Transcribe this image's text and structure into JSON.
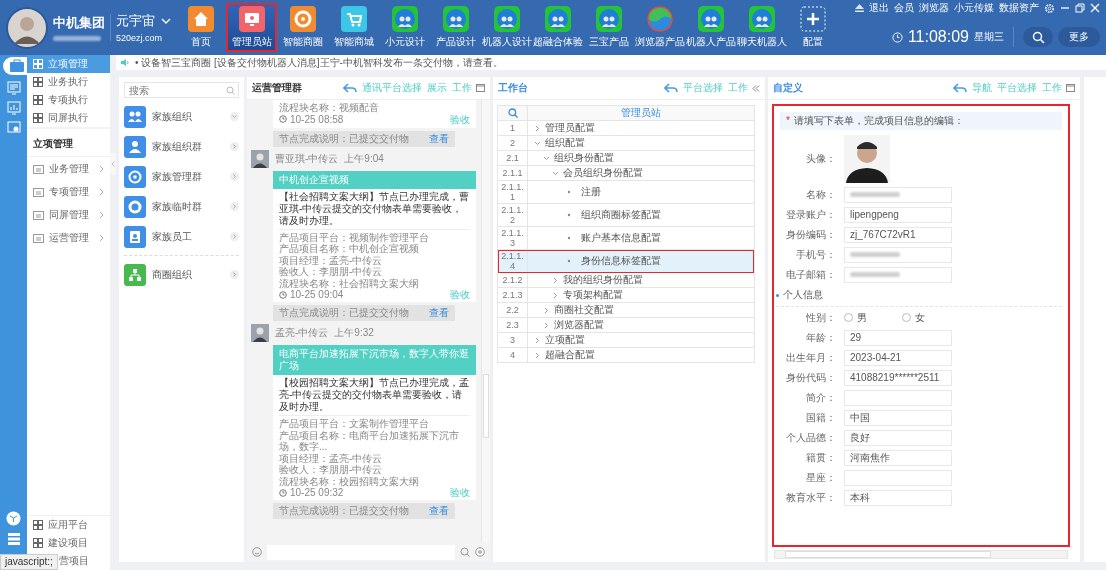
{
  "header": {
    "brand": "中机集团",
    "space": "元宇宙",
    "domain": "520ezj.com",
    "nav": [
      {
        "label": "首页",
        "kind": "home",
        "selected": false
      },
      {
        "label": "管理员站",
        "kind": "monitor",
        "selected": true
      },
      {
        "label": "智能商圈",
        "kind": "aperture",
        "selected": false
      },
      {
        "label": "智能商城",
        "kind": "cart",
        "selected": false
      },
      {
        "label": "小元设计",
        "kind": "globe",
        "selected": false
      },
      {
        "label": "产品设计",
        "kind": "globe",
        "selected": false
      },
      {
        "label": "机器人设计",
        "kind": "globe",
        "selected": false
      },
      {
        "label": "超融合体验",
        "kind": "globe",
        "selected": false
      },
      {
        "label": "三宝产品",
        "kind": "globe",
        "selected": false
      },
      {
        "label": "浏览器产品",
        "kind": "swirl",
        "selected": false
      },
      {
        "label": "机器人产品",
        "kind": "globe",
        "selected": false
      },
      {
        "label": "聊天机器人",
        "kind": "globe",
        "selected": false
      },
      {
        "label": "配置",
        "kind": "plus",
        "selected": false
      }
    ],
    "links": [
      "退出",
      "会员",
      "浏览器",
      "小元传媒",
      "数据资产"
    ],
    "time": "11:08:09",
    "weekday": "星期三",
    "more": "更多"
  },
  "sidebar": {
    "top": [
      {
        "label": "立项管理",
        "selected": true
      },
      {
        "label": "业务执行",
        "selected": false
      },
      {
        "label": "专项执行",
        "selected": false
      },
      {
        "label": "同屏执行",
        "selected": false
      }
    ],
    "heading": "立项管理",
    "folders": [
      "业务管理",
      "专项管理",
      "同屏管理",
      "运营管理"
    ],
    "bottom": [
      {
        "label": "应用平台"
      },
      {
        "label": "建设项目"
      }
    ],
    "covered_item": "营项目",
    "status_tip": "javascript:;"
  },
  "notice": "• 设备智三宝商圈 [设备交付物机器人消息]王宁-中机智科发布一条交付物，请查看。",
  "groups": {
    "placeholder": "搜索",
    "items": [
      {
        "label": "家族组织",
        "kind": "people",
        "expanded": true
      },
      {
        "label": "家族组织群",
        "kind": "person",
        "expanded": false
      },
      {
        "label": "家族管理群",
        "kind": "target",
        "expanded": false
      },
      {
        "label": "家族临时群",
        "kind": "ring",
        "expanded": false
      },
      {
        "label": "家族员工",
        "kind": "badge",
        "expanded": false
      },
      {
        "label": "商圈组织",
        "kind": "org",
        "expanded": false
      }
    ]
  },
  "chat": {
    "title": "运营管理群",
    "actions": [
      "通讯平台选择",
      "展示",
      "工作"
    ],
    "messages": [
      {
        "kind": "tail",
        "lines": [
          "流程块名称：视频配音"
        ],
        "stamp": "10-25 08:58",
        "action": "验收"
      },
      {
        "kind": "note",
        "text": "节点完成说明：已提交交付物",
        "link": "查看"
      },
      {
        "kind": "card",
        "sender": "曹亚琪-中传云",
        "time": "上午9:04",
        "banner": "中机创企宣视频",
        "body": "【社会招聘文案大纲】节点已办理完成，曹亚琪-中传云提交的交付物表单需要验收，请及时办理。",
        "lines": [
          "产品项目平台：视频制作管理平台",
          "产品项目名称：中机创企宣视频",
          "项目经理：孟亮-中传云",
          "验收人：李朋朋-中传云",
          "流程块名称：社会招聘文案大纲"
        ],
        "stamp": "10-25 09:04",
        "action": "验收"
      },
      {
        "kind": "note",
        "text": "节点完成说明：已提交交付物",
        "link": "查看"
      },
      {
        "kind": "card",
        "sender": "孟亮-中传云",
        "time": "上午9:32",
        "banner": "电商平台加速拓展下沉市场，数字人带你逛广场",
        "body": "【校园招聘文案大纲】节点已办理完成，孟亮-中传云提交的交付物表单需要验收，请及时办理。",
        "lines": [
          "产品项目平台：文案制作管理平台",
          "产品项目名称：电商平台加速拓展下沉市场，数字...",
          "项目经理：孟亮-中传云",
          "验收人：李朋朋-中传云",
          "流程块名称：校园招聘文案大纲"
        ],
        "stamp": "10-25 09:32",
        "action": "验收"
      },
      {
        "kind": "note",
        "text": "节点完成说明：已提交交付物",
        "link": "查看"
      }
    ]
  },
  "workbench": {
    "title": "工作台",
    "actions": [
      "平台选择",
      "工作"
    ],
    "column": "管理员站",
    "tree": [
      {
        "num": "1",
        "label": "管理员配置",
        "expanded": false,
        "selected": false
      },
      {
        "num": "2",
        "label": "组织配置",
        "expanded": true,
        "selected": false,
        "children": [
          {
            "num": "2.1",
            "label": "组织身份配置",
            "expanded": true,
            "selected": false,
            "children": [
              {
                "num": "2.1.1",
                "label": "会员组织身份配置",
                "expanded": true,
                "selected": false,
                "children": [
                  {
                    "num": "2.1.1.1",
                    "label": "注册",
                    "selected": false
                  },
                  {
                    "num": "2.1.1.2",
                    "label": "组织商圈标签配置",
                    "selected": false
                  },
                  {
                    "num": "2.1.1.3",
                    "label": "账户基本信息配置",
                    "selected": false
                  },
                  {
                    "num": "2.1.1.4",
                    "label": "身份信息标签配置",
                    "selected": true
                  }
                ]
              },
              {
                "num": "2.1.2",
                "label": "我的组织身份配置",
                "expanded": false,
                "selected": false
              },
              {
                "num": "2.1.3",
                "label": "专项架构配置",
                "expanded": false,
                "selected": false
              }
            ]
          },
          {
            "num": "2.2",
            "label": "商圈社交配置",
            "expanded": false,
            "selected": false
          },
          {
            "num": "2.3",
            "label": "浏览器配置",
            "expanded": false,
            "selected": false
          }
        ]
      },
      {
        "num": "3",
        "label": "立项配置",
        "expanded": false,
        "selected": false
      },
      {
        "num": "4",
        "label": "超融合配置",
        "expanded": false,
        "selected": false
      }
    ]
  },
  "form": {
    "title": "自定义",
    "actions": [
      "导航",
      "平台选择",
      "工作"
    ],
    "required_mark": "*",
    "hint": "请填写下表单，完成项目信息的编辑：",
    "fields": [
      {
        "label": "头像：",
        "kind": "avatar"
      },
      {
        "label": "名称：",
        "kind": "redacted"
      },
      {
        "label": "登录账户：",
        "kind": "text",
        "value": "lipengpeng"
      },
      {
        "label": "身份编码：",
        "kind": "text",
        "value": "zj_767C72vR1"
      },
      {
        "label": "手机号：",
        "kind": "redacted"
      },
      {
        "label": "电子邮箱：",
        "kind": "redacted"
      }
    ],
    "section": "个人信息",
    "personal": [
      {
        "label": "性别：",
        "kind": "radio",
        "options": [
          {
            "label": "男",
            "selected": false
          },
          {
            "label": "女",
            "selected": false
          }
        ]
      },
      {
        "label": "年龄：",
        "kind": "text",
        "value": "29"
      },
      {
        "label": "出生年月：",
        "kind": "text",
        "value": "2023-04-21"
      },
      {
        "label": "身份代码：",
        "kind": "text",
        "value": "41088219******2511"
      },
      {
        "label": "简介：",
        "kind": "text"
      },
      {
        "label": "国籍：",
        "kind": "text",
        "value": "中国"
      },
      {
        "label": "个人品德：",
        "kind": "text",
        "value": "良好"
      },
      {
        "label": "籍贯：",
        "kind": "text",
        "value": "河南焦作"
      },
      {
        "label": "星座：",
        "kind": "text"
      },
      {
        "label": "教育水平：",
        "kind": "text",
        "value": "本科"
      }
    ]
  }
}
